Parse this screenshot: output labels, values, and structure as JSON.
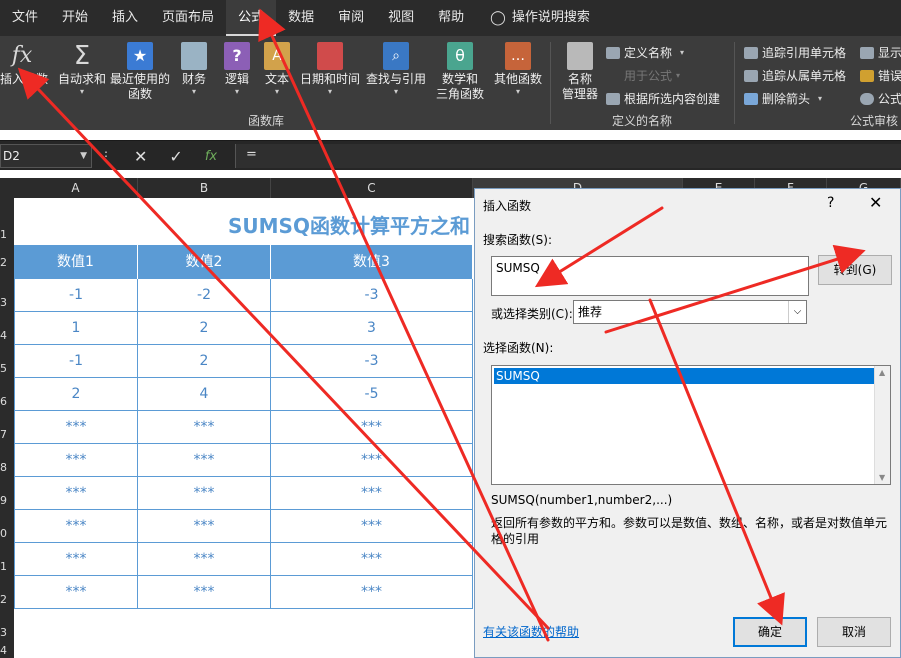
{
  "menu": {
    "tabs": [
      "文件",
      "开始",
      "插入",
      "页面布局",
      "公式",
      "数据",
      "审阅",
      "视图",
      "帮助"
    ],
    "active_tab": "公式",
    "tell_me": "操作说明搜索"
  },
  "ribbon": {
    "function_library": {
      "buttons": [
        {
          "label": "插入函数",
          "caret": ""
        },
        {
          "label": "自动求和",
          "caret": "▾"
        },
        {
          "label": "最近使用的",
          "label2": "函数",
          "caret": "▾"
        },
        {
          "label": "财务",
          "caret": "▾"
        },
        {
          "label": "逻辑",
          "caret": "▾"
        },
        {
          "label": "文本",
          "caret": "▾"
        },
        {
          "label": "日期和时间",
          "caret": "▾"
        },
        {
          "label": "查找与引用",
          "caret": "▾"
        },
        {
          "label": "数学和",
          "label2": "三角函数",
          "caret": "▾"
        },
        {
          "label": "其他函数",
          "caret": "▾"
        }
      ],
      "group_label": "函数库"
    },
    "defined_names": {
      "name_manager": "名称",
      "name_manager2": "管理器",
      "define_name": "定义名称",
      "use_in_formula": "用于公式",
      "create_from_selection": "根据所选内容创建",
      "group_label": "定义的名称"
    },
    "formula_auditing": {
      "trace_precedents": "追踪引用单元格",
      "trace_dependents": "追踪从属单元格",
      "remove_arrows": "删除箭头",
      "show": "显示",
      "error": "错误",
      "formula": "公式",
      "group_label": "公式审核"
    },
    "colors": {
      "fx": "#d9d9d9",
      "sum": "#d9d9d9",
      "recent": "#3b7bd4",
      "finance": "#9ab3c4",
      "logic": "#8c5fb6",
      "text": "#d2a24b",
      "date": "#d04b4b",
      "lookup": "#3a78c4",
      "math": "#4aa58f",
      "more": "#c6643a"
    }
  },
  "formula_bar": {
    "name_box": "D2",
    "cancel_icon": "✕",
    "enter_icon": "✓",
    "fx_icon": "fx",
    "content": "="
  },
  "columns": [
    "A",
    "B",
    "C",
    "D",
    "E",
    "F",
    "G"
  ],
  "rows": [
    "1",
    "2",
    "3",
    "4",
    "5",
    "6",
    "7",
    "8",
    "9",
    "0",
    "1",
    "2",
    "3",
    "4"
  ],
  "sheet": {
    "title": "SUMSQ函数计算平方之和",
    "headers": [
      "数值1",
      "数值2",
      "数值3"
    ],
    "data": [
      [
        "-1",
        "-2",
        "-3"
      ],
      [
        "1",
        "2",
        "3"
      ],
      [
        "-1",
        "2",
        "-3"
      ],
      [
        "2",
        "4",
        "-5"
      ],
      [
        "***",
        "***",
        "***"
      ],
      [
        "***",
        "***",
        "***"
      ],
      [
        "***",
        "***",
        "***"
      ],
      [
        "***",
        "***",
        "***"
      ],
      [
        "***",
        "***",
        "***"
      ],
      [
        "***",
        "***",
        "***"
      ]
    ]
  },
  "dialog": {
    "title": "插入函数",
    "help_q": "?",
    "close": "✕",
    "search_label": "搜索函数(S):",
    "search_value": "SUMSQ",
    "goto_button": "转到(G)",
    "category_label": "或选择类别(C):",
    "category_value": "推荐",
    "select_label": "选择函数(N):",
    "functions": [
      "SUMSQ"
    ],
    "signature": "SUMSQ(number1,number2,...)",
    "description": "返回所有参数的平方和。参数可以是数值、数组、名称，或者是对数值单元格的引用",
    "help_link": "有关该函数的帮助",
    "ok_button": "确定",
    "cancel_button": "取消"
  }
}
